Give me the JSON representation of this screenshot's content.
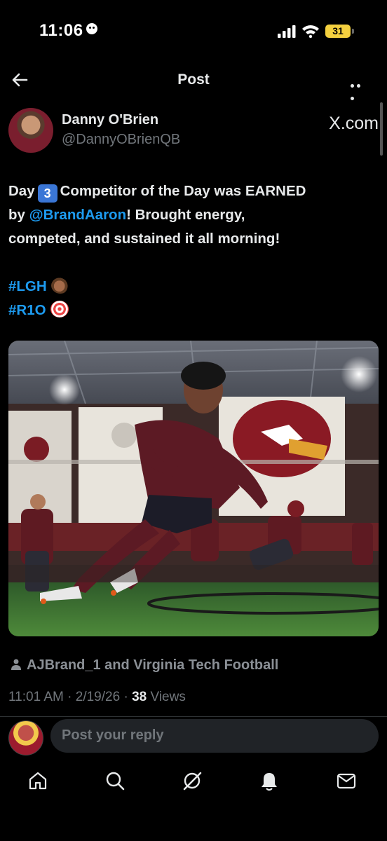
{
  "status_bar": {
    "time": "11:06",
    "battery": "31"
  },
  "header": {
    "title": "Post"
  },
  "author": {
    "display_name": "Danny O'Brien",
    "handle": "@DannyOBrienQB",
    "source_badge": "X.com"
  },
  "post": {
    "line1_a": "Day",
    "keycap": "3",
    "line1_b": "Competitor of the Day was EARNED",
    "line2_a": "by",
    "mention": "@BrandAaron",
    "line2_b": "! Brought energy,",
    "line3": "competed, and sustained it all morning!",
    "hashtag1": "#LGH",
    "hashtag2": "#R1O"
  },
  "social_context": "AJBrand_1 and Virginia Tech Football",
  "meta": {
    "time": "11:01 AM",
    "date": "2/19/26",
    "views_count": "38",
    "views_label": "Views"
  },
  "reply": {
    "placeholder": "Post your reply"
  },
  "colors": {
    "link": "#1d9bf0",
    "background": "#000000",
    "muted": "#71767b"
  },
  "icons": {
    "header": [
      "back-arrow-icon",
      "more-icon"
    ],
    "tabbar": [
      "home-icon",
      "search-icon",
      "grok-icon",
      "notifications-icon",
      "messages-icon"
    ]
  }
}
